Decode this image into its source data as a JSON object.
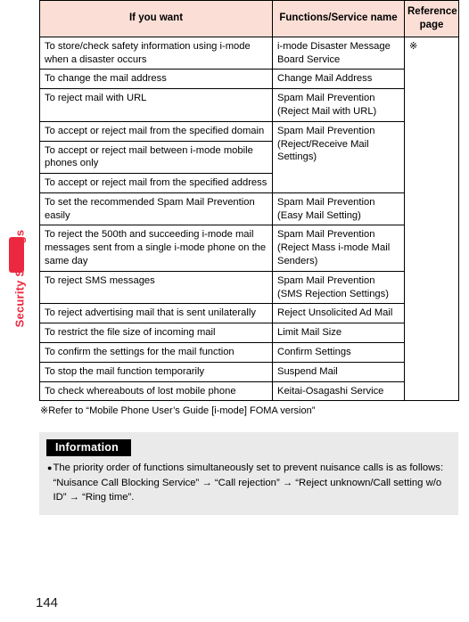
{
  "sidebar": {
    "chapter_label": "Security Settings",
    "tab_color": "#ec2840"
  },
  "page_number": "144",
  "table": {
    "header_background": "#fbdfd6",
    "columns": [
      "If you want",
      "Functions/Service name",
      "Reference page"
    ],
    "reference_mark": "※",
    "rows": [
      {
        "want": "To store/check safety information using i-mode when a disaster occurs",
        "func": "i-mode Disaster Message Board Service"
      },
      {
        "want": "To change the mail address",
        "func": "Change Mail Address"
      },
      {
        "want": "To reject mail with URL",
        "func": "Spam Mail Prevention (Reject Mail with URL)"
      },
      {
        "want": "To accept or reject mail from the specified domain",
        "func": "Spam Mail Prevention (Reject/Receive Mail Settings)"
      },
      {
        "want": "To accept or reject mail between i-mode mobile phones only",
        "func": ""
      },
      {
        "want": "To accept or reject mail from the specified address",
        "func": ""
      },
      {
        "want": "To set the recommended Spam Mail Prevention easily",
        "func": "Spam Mail Prevention (Easy Mail Setting)"
      },
      {
        "want": "To reject the 500th and succeeding i-mode mail messages sent from a single i-mode phone on the same day",
        "func": "Spam Mail Prevention (Reject Mass i-mode Mail Senders)"
      },
      {
        "want": "To reject SMS messages",
        "func": "Spam Mail Prevention (SMS Rejection Settings)"
      },
      {
        "want": "To reject advertising mail that is sent unilaterally",
        "func": "Reject Unsolicited Ad Mail"
      },
      {
        "want": "To restrict the file size of incoming mail",
        "func": "Limit Mail Size"
      },
      {
        "want": "To confirm the settings for the mail function",
        "func": "Confirm Settings"
      },
      {
        "want": "To stop the mail function temporarily",
        "func": "Suspend Mail"
      },
      {
        "want": "To check whereabouts of lost mobile phone",
        "func": "Keitai-Osagashi Service"
      }
    ]
  },
  "footnote": "※Refer to “Mobile Phone User’s Guide [i-mode] FOMA version”",
  "information": {
    "title": "Information",
    "bullet": "●",
    "text": "The priority order of functions simultaneously set to prevent nuisance calls is as follows: “Nuisance Call Blocking Service” → “Call rejection” → “Reject unknown/Call setting w/o ID” → “Ring time”."
  }
}
